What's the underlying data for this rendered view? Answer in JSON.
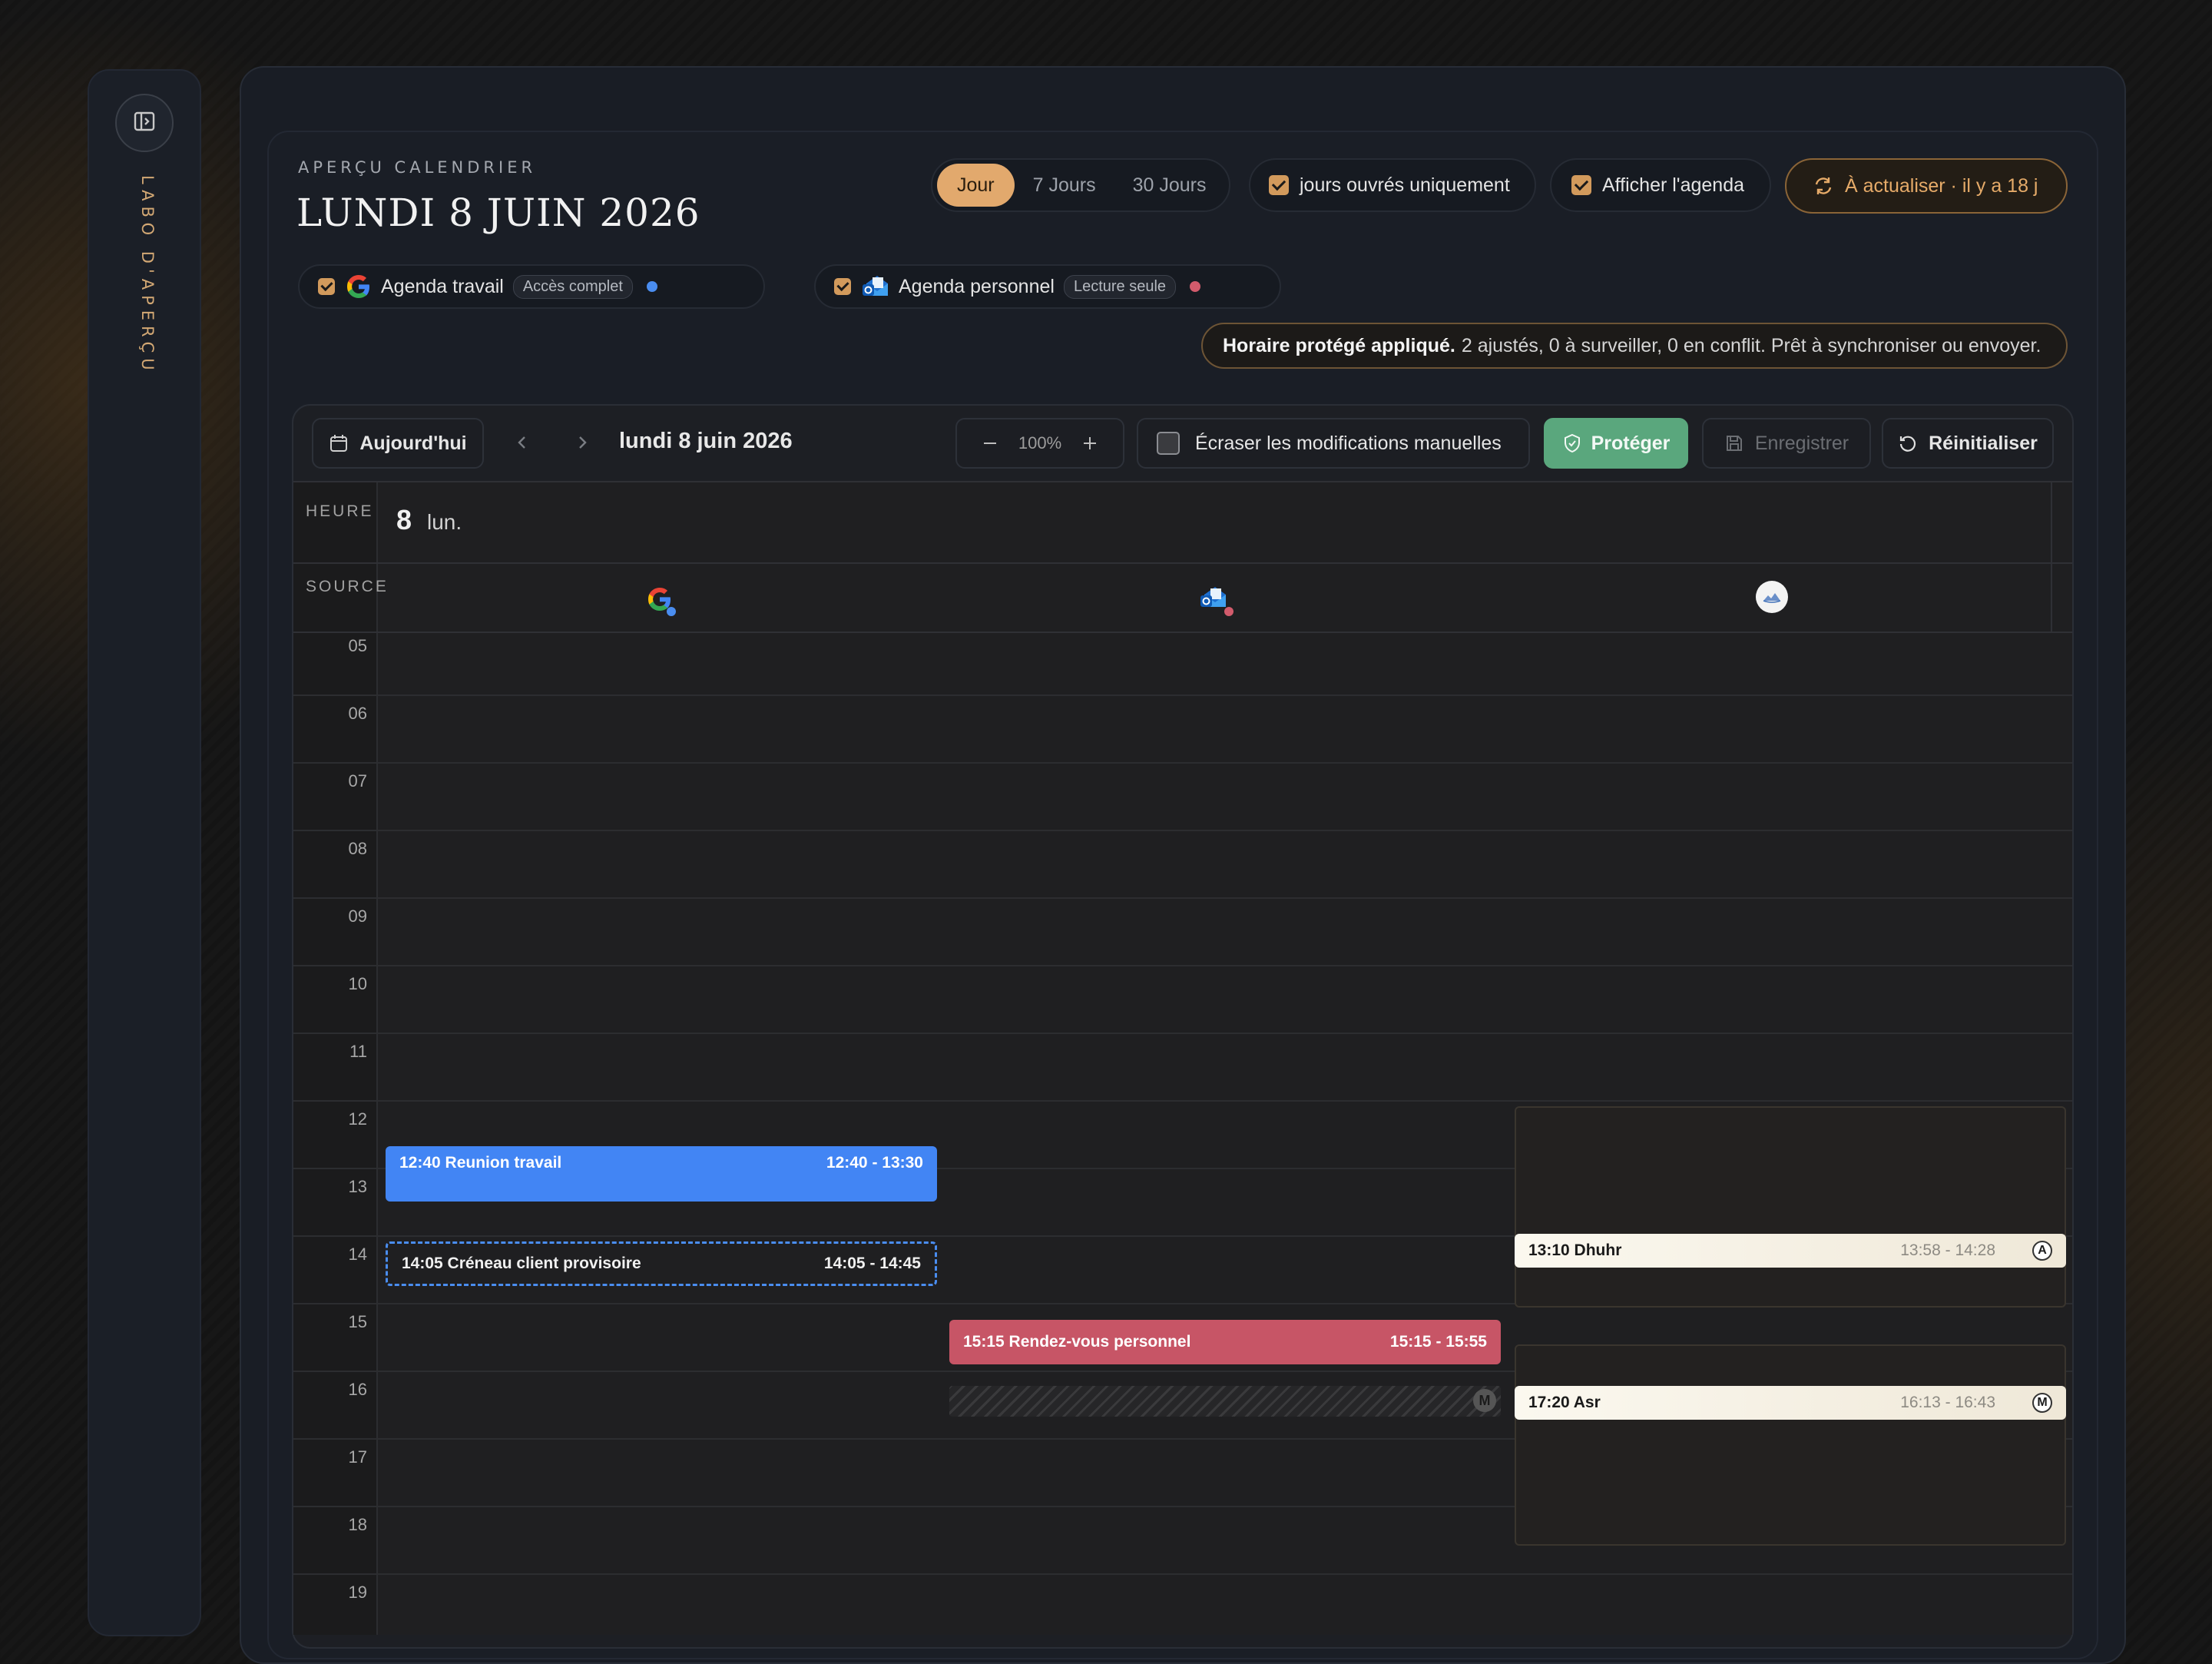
{
  "sidebar": {
    "toggle_icon": "panel-toggle-icon",
    "label": "LABO D'APERÇU"
  },
  "header": {
    "eyebrow": "APERÇU CALENDRIER",
    "title": "LUNDI 8 JUIN 2026",
    "view_options": [
      "Jour",
      "7 Jours",
      "30 Jours"
    ],
    "selected_view": "Jour",
    "workdays_label": "jours ouvrés uniquement",
    "show_agenda_label": "Afficher l'agenda",
    "refresh_label": "À actualiser · il y a 18 j"
  },
  "calendars": [
    {
      "name": "Agenda travail",
      "badge": "Accès complet",
      "color": "#4a8df0",
      "icon": "google-icon"
    },
    {
      "name": "Agenda personnel",
      "badge": "Lecture seule",
      "color": "#d25b6c",
      "icon": "outlook-icon"
    }
  ],
  "status": {
    "bold": "Horaire protégé appliqué.",
    "text": "2 ajustés, 0 à surveiller, 0 en conflit. Prêt à synchroniser ou envoyer."
  },
  "toolbar": {
    "today_label": "Aujourd'hui",
    "date_label": "lundi 8 juin 2026",
    "zoom": "100%",
    "overwrite_label": "Écraser les modifications manuelles",
    "protect_label": "Protéger",
    "save_label": "Enregistrer",
    "reset_label": "Réinitialiser"
  },
  "grid": {
    "hour_header": "HEURE",
    "source_header": "SOURCE",
    "day_number": "8",
    "day_name": "lun.",
    "hours": [
      "05",
      "06",
      "07",
      "08",
      "09",
      "10",
      "11",
      "12",
      "13",
      "14",
      "15",
      "16",
      "17",
      "18",
      "19"
    ]
  },
  "events": {
    "work_meeting": {
      "title": "12:40 Reunion travail",
      "time": "12:40 - 13:30"
    },
    "client_slot": {
      "title": "14:05 Créneau client provisoire",
      "time": "14:05 - 14:45"
    },
    "personal": {
      "title": "15:15 Rendez-vous personnel",
      "time": "15:15 - 15:55"
    },
    "personal_marker": "M",
    "dhuhr": {
      "title": "13:10 Dhuhr",
      "time": "13:58 - 14:28",
      "marker": "A"
    },
    "asr": {
      "title": "17:20 Asr",
      "time": "16:13 - 16:43",
      "marker": "M"
    }
  },
  "colors": {
    "accent": "#e2a96d",
    "work": "#4285f4",
    "personal": "#c75566",
    "protect": "#5aa77d"
  }
}
